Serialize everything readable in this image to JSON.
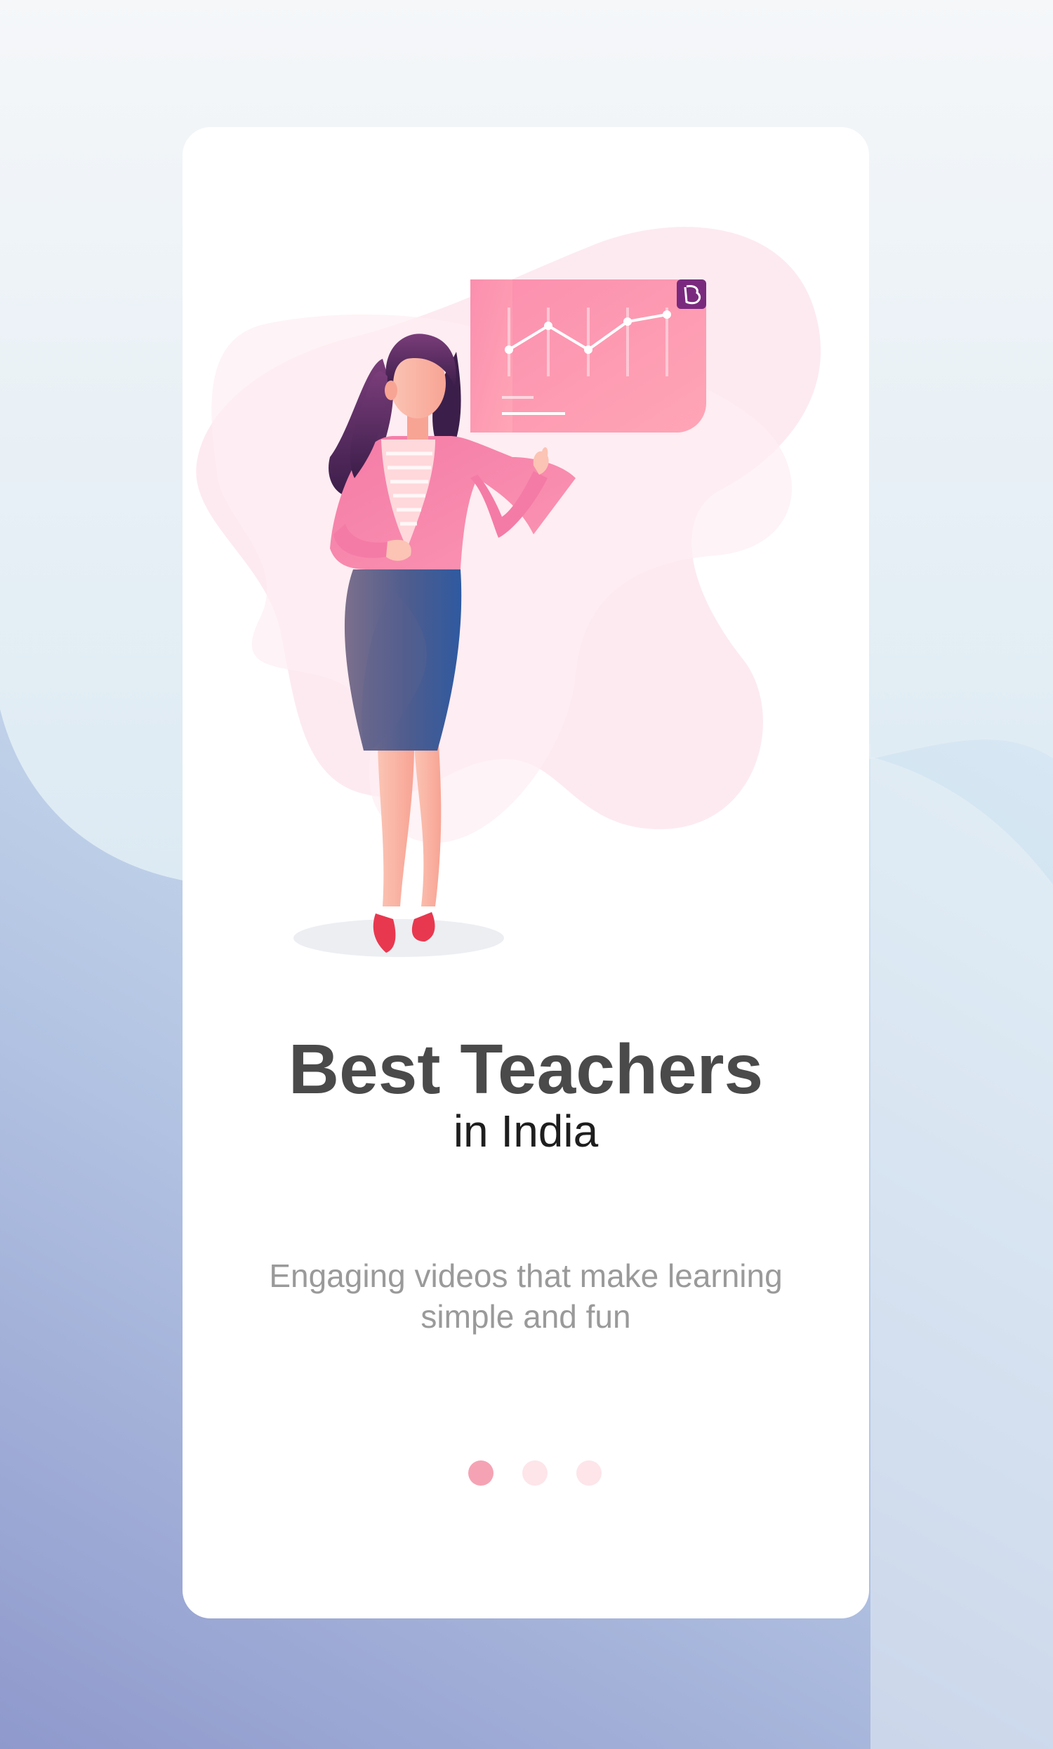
{
  "screen": {
    "title": "Best Teachers",
    "subtitle": "in India",
    "description": "Engaging videos that make learning simple and fun"
  },
  "pagination": {
    "total": 3,
    "active_index": 0,
    "active_color": "#f5a3b4",
    "inactive_color": "#fde5ea"
  },
  "illustration": {
    "subject": "teacher presenting chart",
    "board_logo_icon": "brand-b-logo-icon",
    "colors": {
      "accent_pink": "#f98ea8",
      "blob_pink": "#fde4ec",
      "skirt_blue": "#3f5a99",
      "logo_purple": "#7a2a7e",
      "shoe_red": "#e8384f"
    }
  }
}
